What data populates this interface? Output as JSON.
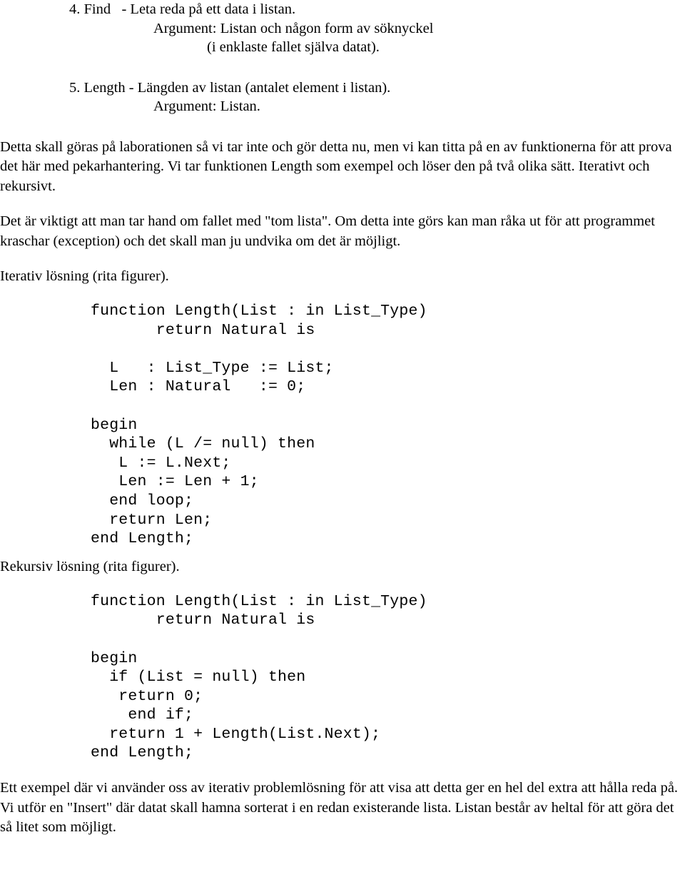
{
  "document": {
    "language": "sv",
    "list_operations": [
      {
        "number": "4.",
        "name": "Find",
        "description": "- Leta reda på ett data i listan.",
        "argument_line_1": "Argument: Listan och någon form av söknyckel",
        "argument_line_2": "(i enklaste fallet själva datat)."
      },
      {
        "number": "5.",
        "name": "Length",
        "description": "- Längden av listan (antalet element i listan).",
        "argument_line_1": "Argument: Listan.",
        "argument_line_2": ""
      }
    ],
    "item4_full_line": "4. Find   - Leta reda på ett data i listan.",
    "item5_full_line": "5. Length - Längden av listan (antalet element i listan).",
    "paragraphs": {
      "lab_intro": "Detta skall göras på laborationen så vi tar inte och gör detta nu, men vi kan titta på en av funktionerna för att prova det här med pekarhantering. Vi tar funktionen Length som exempel och löser den på två olika sätt. Iterativt och rekursivt.",
      "empty_list_warning": "Det är viktigt att man tar hand om fallet med \"tom lista\". Om detta inte görs kan man råka ut för att programmet kraschar (exception) och det skall man ju undvika om det är möjligt.",
      "closing": "Ett exempel där vi använder oss av iterativ problemlösning för att visa att detta ger en hel del extra att hålla reda på. Vi utför en \"Insert\" där datat skall hamna sorterat i en redan existerande lista. Listan består av heltal för att göra det så litet som möjligt."
    },
    "section_labels": {
      "iterative": "Iterativ lösning (rita figurer).",
      "recursive": "Rekursiv lösning (rita figurer)."
    },
    "code_blocks": {
      "iterative": "function Length(List : in List_Type)\n       return Natural is\n\n  L   : List_Type := List;\n  Len : Natural   := 0;\n\nbegin\n  while (L /= null) then\n   L := L.Next;\n   Len := Len + 1;\n  end loop;\n  return Len;\nend Length;",
      "recursive": "function Length(List : in List_Type)\n       return Natural is\n\nbegin\n  if (List = null) then\n   return 0;\n    end if;\n  return 1 + Length(List.Next);\nend Length;"
    },
    "colors": {
      "text": "#000000",
      "background": "#ffffff"
    }
  }
}
